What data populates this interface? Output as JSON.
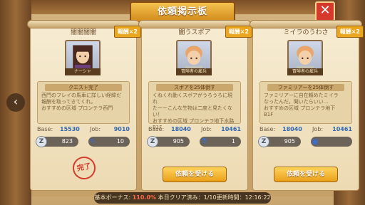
{
  "header": {
    "title": "依頼掲示板",
    "close_icon": "close-icon"
  },
  "cards": [
    {
      "title": "闇闇闇闇",
      "reward_tag": "報酬×2",
      "portrait_label": "ナーシャ",
      "desc_head": "クエスト完了",
      "desc_lines": [
        "西門のフレイの馬車に詳しい経緯だ",
        "報酬を取ってきてくれ。",
        "おすすめの区域 プロンテラ西門"
      ],
      "base_label": "Base:",
      "base_value": "15530",
      "job_label": "Job:",
      "job_value": "9010",
      "zeny": "823",
      "item_count": "10",
      "stamp": "完了",
      "button": ""
    },
    {
      "title": "闇うスポア",
      "reward_tag": "報酬×2",
      "portrait_label": "冒険者の雇兵",
      "desc_head": "スポアを25体倒す",
      "desc_lines": [
        "くねくれ動くスポアがうろうろに現れ",
        "たーーこんな生物は二度と見たくな",
        "い！",
        "おすすめの区域 プロンテラ地下水路",
        "B1F"
      ],
      "base_label": "Base:",
      "base_value": "18040",
      "job_label": "Job:",
      "job_value": "10461",
      "zeny": "905",
      "item_count": "1",
      "stamp": "",
      "button": "依頼を受ける"
    },
    {
      "title": "ミイラのうわさ",
      "reward_tag": "報酬×2",
      "portrait_label": "冒険者の雇兵",
      "desc_head": "ファミリアーを25体倒す",
      "desc_lines": [
        "ファミリアーに自在頼めたミイラ",
        "なったんだ。聞いたらいい...",
        "おすすめの区域 プロンテラ地下",
        "B1F"
      ],
      "base_label": "Base:",
      "base_value": "18040",
      "job_label": "Job:",
      "job_value": "10461",
      "zeny": "905",
      "item_count": "",
      "stamp": "",
      "button": "依頼を受ける"
    }
  ],
  "footer": {
    "prefix": "基本ボーナス:",
    "bonus": "110.0%",
    "rest": "本日クリア済み：1/10更新時間：12:16:22"
  },
  "colors": {
    "accent": "#e9a01b",
    "close": "#d53a2d",
    "value_blue": "#2f66b5",
    "stamp_red": "#d43c2d"
  }
}
